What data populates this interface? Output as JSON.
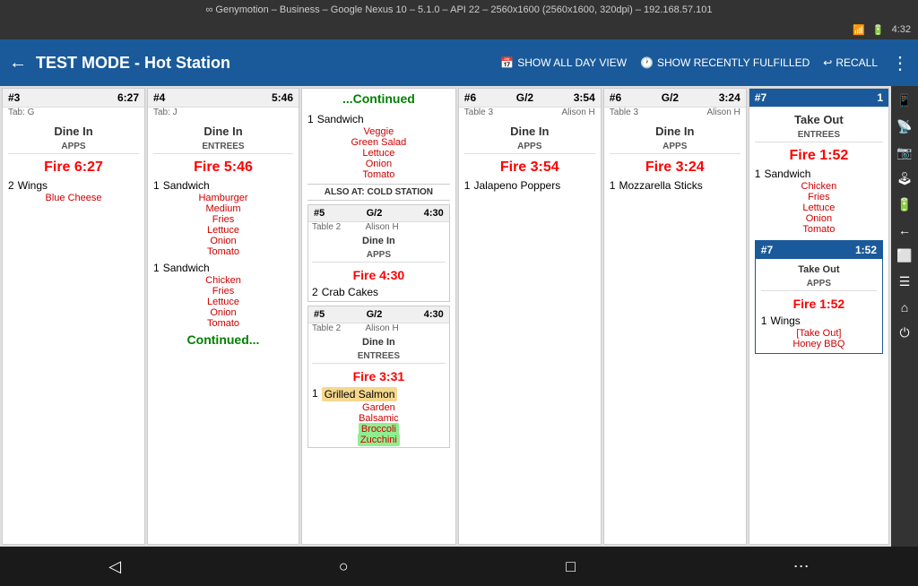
{
  "titleBar": {
    "text": "∞ Genymotion – Business – Google Nexus 10 – 5.1.0 – API 22 – 2560x1600 (2560x1600, 320dpi) – 192.168.57.101"
  },
  "statusBar": {
    "wifi": "📶",
    "battery": "🔋",
    "time": "4:32"
  },
  "header": {
    "backLabel": "←",
    "title": "TEST MODE - Hot Station",
    "showAllDay": "SHOW ALL DAY VIEW",
    "showRecentlyFulfilled": "SHOW RECENTLY FULFILLED",
    "recall": "RECALL",
    "dotsLabel": "⋮"
  },
  "cards": [
    {
      "id": "card3",
      "number": "#3",
      "time": "6:27",
      "tab": "Tab: G",
      "type": "Dine In",
      "sections": [
        {
          "label": "APPS",
          "fireLabel": "Fire  6:27",
          "items": [
            {
              "qty": "2",
              "name": "Wings"
            }
          ],
          "modifiers": [
            "Blue Cheese"
          ]
        }
      ]
    },
    {
      "id": "card4",
      "number": "#4",
      "time": "5:46",
      "tab": "Tab: J",
      "type": "Dine In",
      "sections": [
        {
          "label": "ENTREES",
          "fireLabel": "Fire  5:46",
          "items": [
            {
              "qty": "1",
              "name": "Sandwich"
            }
          ],
          "modifiers": [
            "Hamburger",
            "Medium",
            "Fries",
            "Lettuce",
            "Onion",
            "Tomato"
          ]
        },
        {
          "items2": [
            {
              "qty": "1",
              "name": "Sandwich"
            }
          ],
          "modifiers2": [
            "Chicken",
            "Fries",
            "Lettuce",
            "Onion",
            "Tomato"
          ]
        }
      ],
      "continuedBottom": "Continued..."
    },
    {
      "id": "cardContinued",
      "continued": "...Continued",
      "items": [
        {
          "qty": "1",
          "name": "Sandwich"
        }
      ],
      "modifiers": [
        "Veggie",
        "Green Salad",
        "Lettuce",
        "Onion",
        "Tomato"
      ],
      "alsoAt": "ALSO AT: COLD STATION",
      "subCards": [
        {
          "number": "#5",
          "tableInfo": "Table 2",
          "section": "G/2",
          "time": "4:30",
          "person": "Alison H",
          "type": "Dine In",
          "sectionLabel": "APPS",
          "fireLabel": "Fire  4:30",
          "items": [
            {
              "qty": "2",
              "name": "Crab Cakes"
            }
          ]
        },
        {
          "number": "#5",
          "tableInfo": "Table 2",
          "section": "G/2",
          "time": "4:30",
          "person": "Alison H",
          "type": "Dine In",
          "sectionLabel": "ENTREES",
          "fireLabel": "Fire  3:31",
          "items": [
            {
              "qty": "1",
              "name": "Grilled Salmon",
              "highlighted": true
            }
          ],
          "modifiers": [
            "Garden",
            "Balsamic",
            "Broccoli",
            "Zucchini"
          ],
          "highlightedMods": [
            "Broccoli",
            "Zucchini"
          ]
        }
      ]
    },
    {
      "id": "card6a",
      "number": "#6",
      "section": "G/2",
      "time": "3:54",
      "tableInfo": "Table 3",
      "person": "Alison H",
      "type": "Dine In",
      "sections": [
        {
          "label": "APPS",
          "fireLabel": "Fire  3:54",
          "items": [
            {
              "qty": "1",
              "name": "Jalapeno Poppers"
            }
          ]
        }
      ]
    },
    {
      "id": "card6b",
      "number": "#6",
      "section": "G/2",
      "time": "3:24",
      "tableInfo": "Table 3",
      "person": "Alison H",
      "type": "Dine In",
      "sections": [
        {
          "label": "APPS",
          "fireLabel": "Fire  3:24",
          "items": [
            {
              "qty": "1",
              "name": "Mozzarella Sticks"
            }
          ]
        }
      ]
    },
    {
      "id": "card7a",
      "number": "#7",
      "time": "1",
      "isBlue": true,
      "type": "Take Out",
      "sections": [
        {
          "label": "ENTREES",
          "fireLabel": "Fire  1:52",
          "items": [
            {
              "qty": "1",
              "name": "Sandwich"
            }
          ],
          "modifiers": [
            "Chicken",
            "Fries",
            "Lettuce",
            "Onion",
            "Tomato"
          ]
        }
      ]
    },
    {
      "id": "card7b",
      "number": "#7",
      "time": "1:52",
      "isBlue": true,
      "type": "Take Out",
      "sections": [
        {
          "label": "APPS",
          "fireLabel": "Fire  1:52",
          "items": [
            {
              "qty": "1",
              "name": "Wings"
            }
          ],
          "modifiers": [
            "[Take Out]",
            "Honey BBQ"
          ]
        }
      ]
    }
  ],
  "bottomNav": {
    "back": "◁",
    "home": "○",
    "recent": "□",
    "dots": "⋯"
  }
}
